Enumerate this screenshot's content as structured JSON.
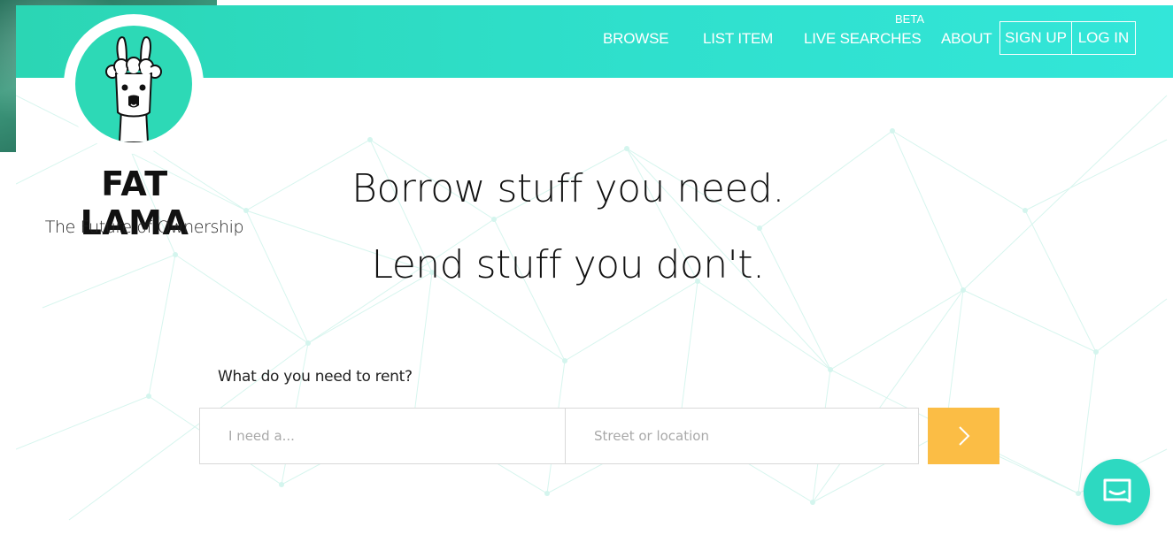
{
  "brand": {
    "name": "FAT LAMA",
    "tagline": "The Future of Ownership"
  },
  "nav": {
    "items": [
      {
        "label": "BROWSE"
      },
      {
        "label": "LIST ITEM"
      },
      {
        "label": "LIVE SEARCHES",
        "badge": "BETA"
      },
      {
        "label": "ABOUT"
      }
    ],
    "sign_up": "SIGN UP",
    "log_in": "LOG IN"
  },
  "hero": {
    "line1": "Borrow stuff you need.",
    "line2": "Lend stuff you don't."
  },
  "search": {
    "label": "What do you need to rent?",
    "item_placeholder": "I need a...",
    "location_placeholder": "Street or location",
    "submit_icon": "chevron-right-icon"
  },
  "chat": {
    "icon": "chat-bubble-icon"
  },
  "colors": {
    "brand_teal": "#2dd9b6",
    "submit_orange": "#fbbd45"
  }
}
